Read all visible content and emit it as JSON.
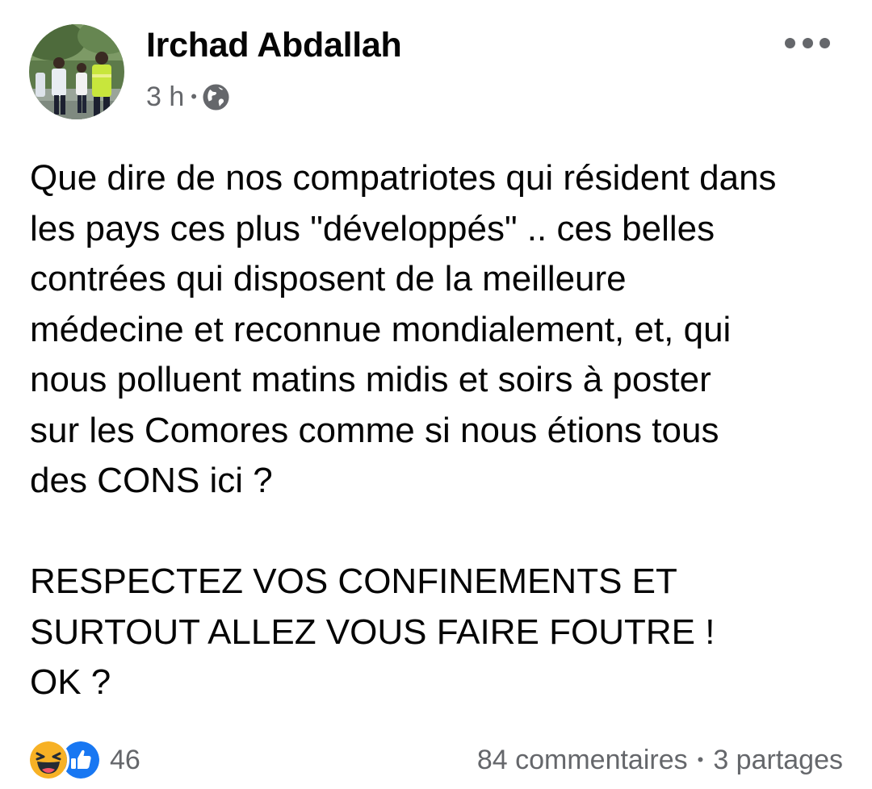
{
  "post": {
    "author": {
      "name": "Irchad Abdallah",
      "avatar": "profile-photo-avatar"
    },
    "meta": {
      "time": "3 h",
      "separator": "•",
      "privacy_icon": "globe-icon"
    },
    "menu_icon": "more-options-icon",
    "text_lines": [
      "Que dire de nos compatriotes qui résident dans",
      "les pays ces plus \"développés\" .. ces belles",
      "contrées qui disposent de la meilleure",
      "médecine et reconnue mondialement, et, qui",
      "nous polluent matins midis et soirs à poster",
      "sur les Comores comme si nous étions tous",
      "des CONS ici ?"
    ],
    "text_lines_2": [
      "RESPECTEZ VOS CONFINEMENTS ET",
      "SURTOUT ALLEZ VOUS FAIRE FOUTRE !",
      "OK ?"
    ],
    "reactions": {
      "icons": [
        "haha-reaction-icon",
        "like-reaction-icon"
      ],
      "count": "46"
    },
    "engagement": {
      "comments": "84 commentaires",
      "separator": "•",
      "shares": "3 partages"
    },
    "colors": {
      "text_primary": "#050505",
      "text_secondary": "#65676b",
      "like_blue": "#1877f2",
      "haha_yellow": "#f7b125"
    }
  }
}
